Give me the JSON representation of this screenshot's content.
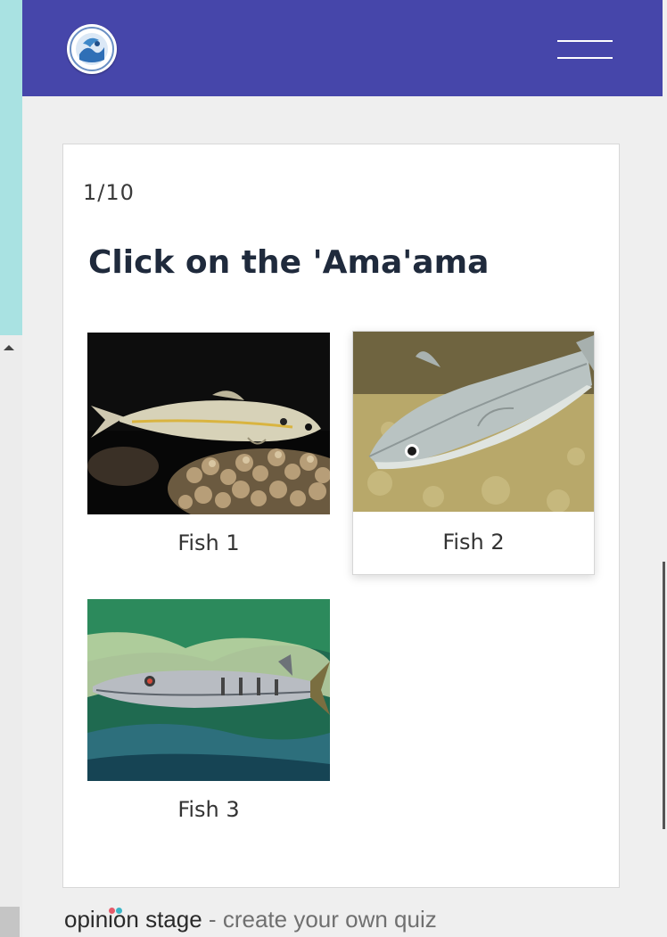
{
  "header": {
    "logo_icon": "organization-seal-logo",
    "menu_icon": "hamburger-menu-icon",
    "bg_color": "#4646aa"
  },
  "quiz": {
    "progress": "1/10",
    "question": "Click on the 'Ama'ama",
    "options": [
      {
        "label": "Fish 1",
        "image": "goatfish-over-coral-photo",
        "selected": false
      },
      {
        "label": "Fish 2",
        "image": "mullet-on-sand-photo",
        "selected": true
      },
      {
        "label": "Fish 3",
        "image": "barracuda-photo",
        "selected": false
      }
    ]
  },
  "footer": {
    "brand": "opinion stage",
    "separator": "-",
    "tagline": "create your own quiz",
    "dot_colors": [
      "#e55a6a",
      "#3ab5c7"
    ]
  }
}
